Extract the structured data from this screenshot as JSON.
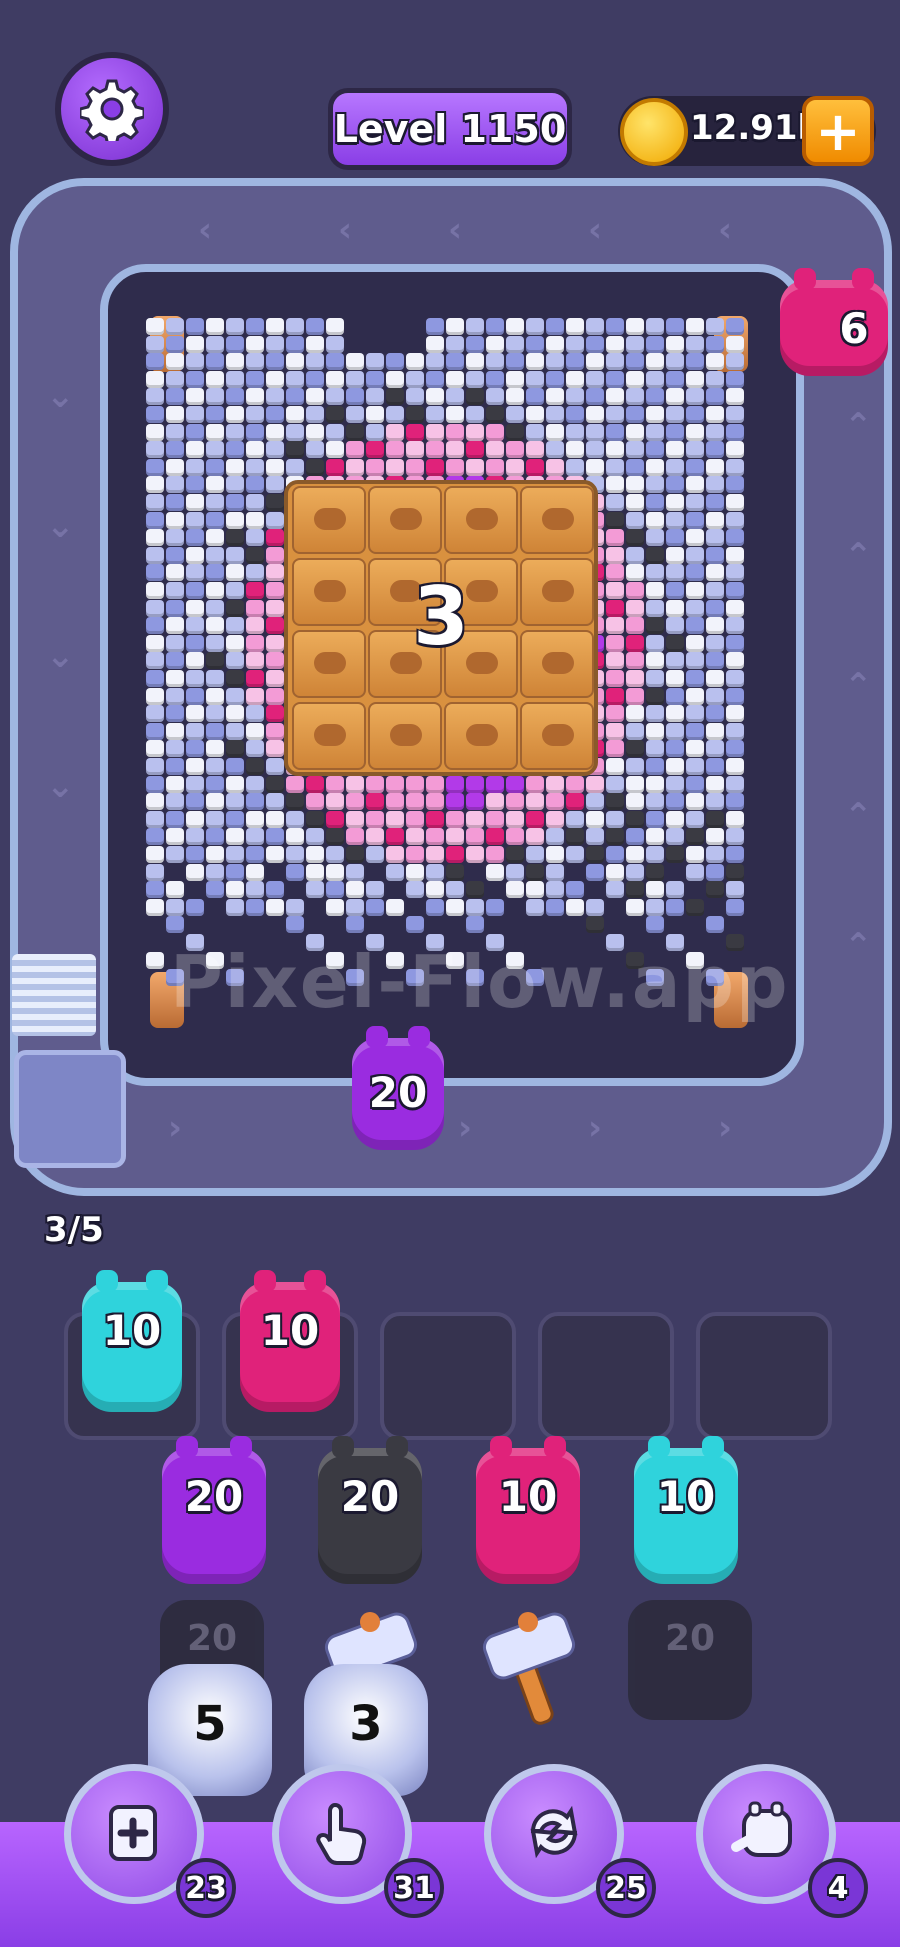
{
  "header": {
    "level_label": "Level 1150",
    "coins": "12.91k",
    "add_coins_icon": "plus-icon",
    "settings_icon": "gear-icon"
  },
  "board": {
    "crate_count": "3",
    "watermark": "Pixel-Flow.app",
    "queue_counter": "3/5",
    "track_pig": {
      "value": "6",
      "color": "#e0227a"
    },
    "conveyor_pig": {
      "value": "20",
      "color": "#9a2ce0"
    }
  },
  "slots": [
    {
      "value": "10",
      "color": "#2fd3dc"
    },
    {
      "value": "10",
      "color": "#e0227a"
    },
    {
      "value": "",
      "color": ""
    },
    {
      "value": "",
      "color": ""
    },
    {
      "value": "",
      "color": ""
    }
  ],
  "front_row": [
    {
      "value": "20",
      "color": "#9a2ce0"
    },
    {
      "value": "20",
      "color": "#3a3a42"
    },
    {
      "value": "10",
      "color": "#e0227a"
    },
    {
      "value": "10",
      "color": "#2fd3dc"
    }
  ],
  "back_row": [
    {
      "value": "20",
      "kind": "hidden-pig"
    },
    {
      "value": "",
      "kind": "hammer"
    },
    {
      "value": "",
      "kind": "hammer"
    },
    {
      "value": "20",
      "kind": "hidden-pig"
    }
  ],
  "jars": [
    {
      "value": "5"
    },
    {
      "value": "3"
    }
  ],
  "boosters": [
    {
      "icon": "add-slot-icon",
      "count": "23"
    },
    {
      "icon": "hand-pointer-icon",
      "count": "31"
    },
    {
      "icon": "shuffle-icon",
      "count": "25"
    },
    {
      "icon": "vacuum-pig-icon",
      "count": "4"
    }
  ],
  "colors": {
    "white": "#f2f3fb",
    "lavender": "#b9c0ee",
    "periwinkle": "#8e98e0",
    "pink": "#f39bd6",
    "light_pink": "#f7c2e6",
    "magenta": "#e0227a",
    "purple": "#b23ae8",
    "dark": "#3a3a42"
  }
}
